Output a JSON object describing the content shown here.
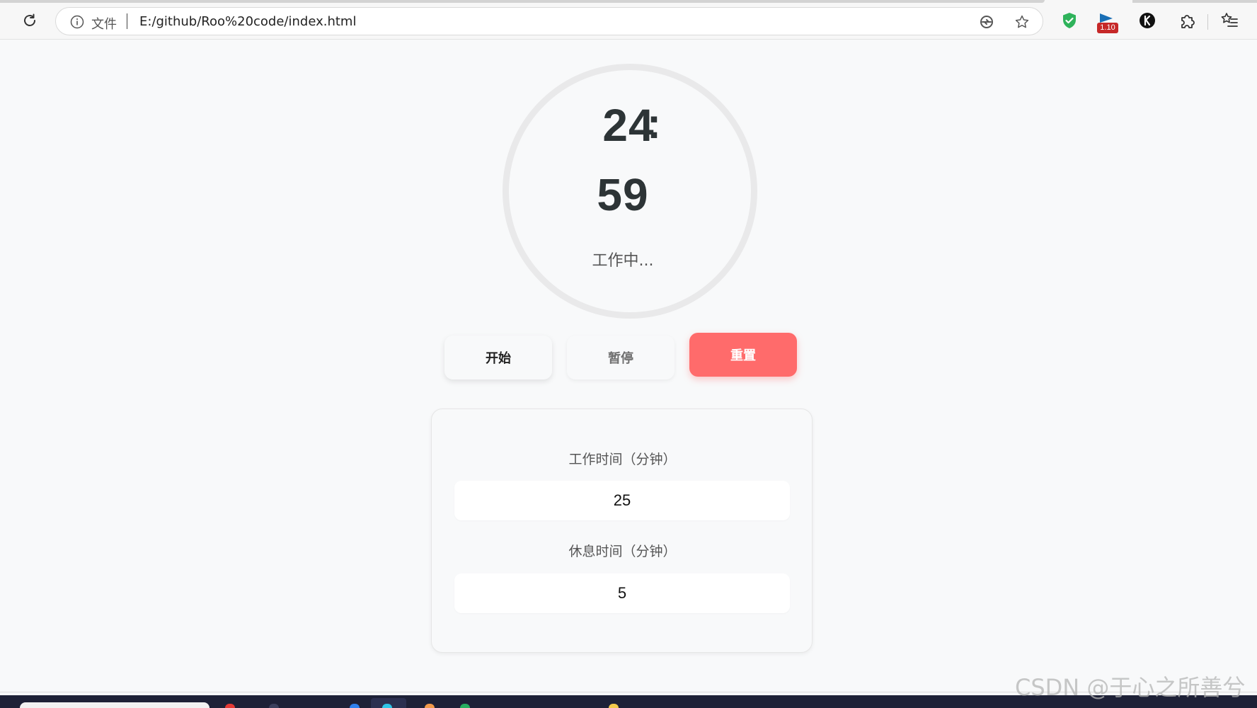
{
  "browser": {
    "scheme_label": "文件",
    "url": "E:/github/Roo%20code/index.html",
    "extensions": [
      {
        "name": "shield-extension",
        "icon": "shield-check-icon",
        "color": "#2fb35b"
      },
      {
        "name": "flag-extension",
        "icon": "flag-icon",
        "badge": "1.10",
        "color": "#1a6fb5"
      },
      {
        "name": "k-extension",
        "icon": "k-circle-icon",
        "color": "#111111"
      },
      {
        "name": "extensions-menu",
        "icon": "puzzle-icon"
      },
      {
        "name": "favorites",
        "icon": "favorites-icon"
      }
    ]
  },
  "timer": {
    "minutes": "24",
    "colon": ":",
    "seconds": "59",
    "status": "工作中..."
  },
  "controls": {
    "start_label": "开始",
    "pause_label": "暂停",
    "reset_label": "重置",
    "accent_color": "#ff6b6b"
  },
  "settings": {
    "work_label": "工作时间（分钟）",
    "work_value": "25",
    "break_label": "休息时间（分钟）",
    "break_value": "5"
  },
  "watermark": "CSDN @于心之所善兮"
}
